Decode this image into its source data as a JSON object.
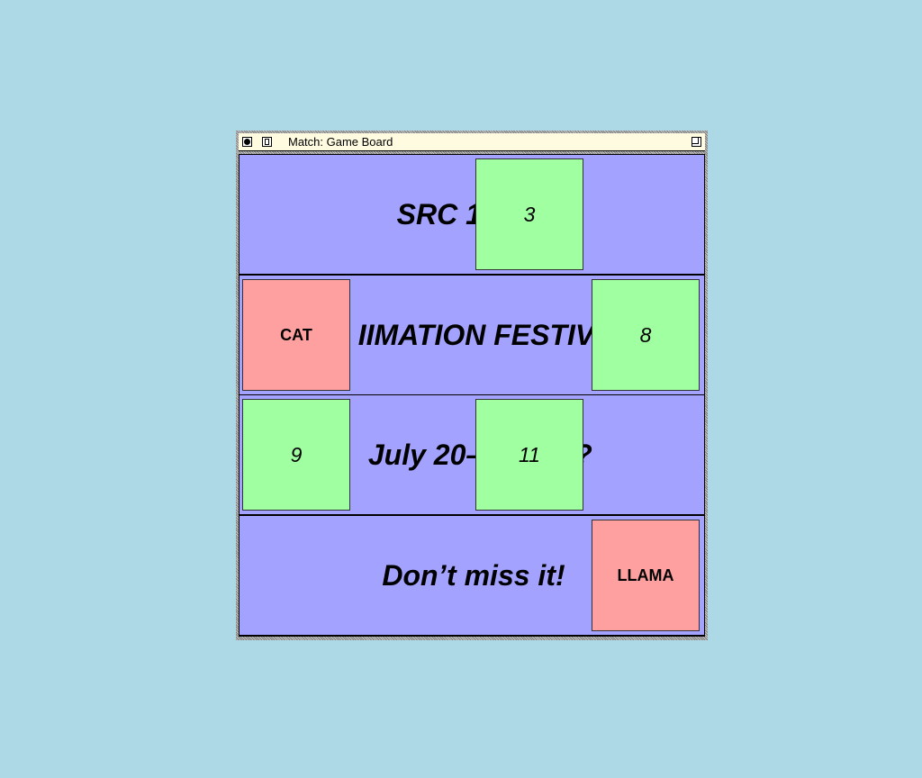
{
  "window": {
    "title": "Match: Game Board"
  },
  "rows": [
    {
      "text": "SRC 1st"
    },
    {
      "text": "IIMATION FESTIV"
    },
    {
      "text": "July 20–",
      "tail": "?"
    },
    {
      "text": "Don’t miss it!"
    }
  ],
  "tiles": [
    {
      "label": "3",
      "state": "matched"
    },
    {
      "label": "CAT",
      "state": "face-up"
    },
    {
      "label": "8",
      "state": "matched"
    },
    {
      "label": "9",
      "state": "matched"
    },
    {
      "label": "11",
      "state": "matched"
    },
    {
      "label": "LLAMA",
      "state": "face-up"
    }
  ],
  "colors": {
    "desktop": "#add8e6",
    "row_background": "#a3a3ff",
    "matched_tile": "#a0ffa0",
    "face_up_tile": "#ffa0a0"
  }
}
